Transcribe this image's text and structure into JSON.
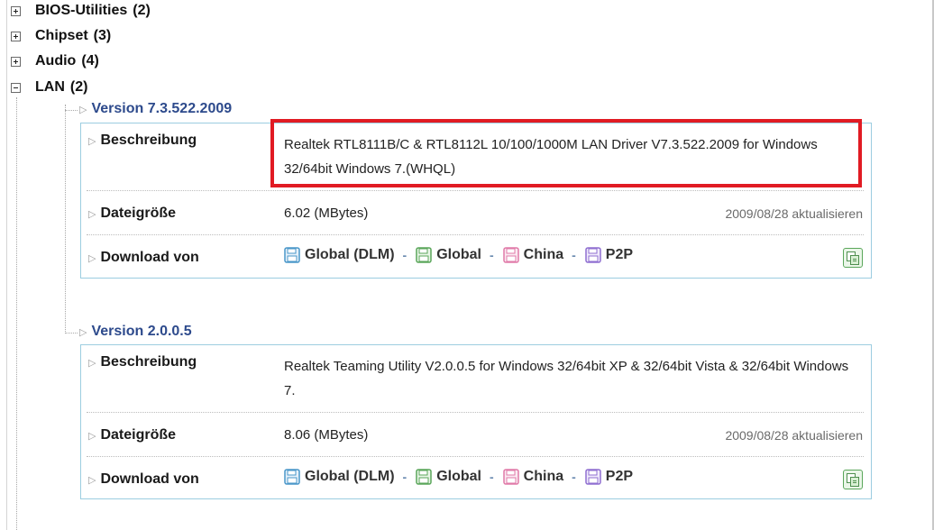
{
  "categories": [
    {
      "name": "BIOS-Utilities",
      "count": "(2)",
      "state": "collapsed"
    },
    {
      "name": "Chipset",
      "count": "(3)",
      "state": "collapsed"
    },
    {
      "name": "Audio",
      "count": "(4)",
      "state": "collapsed"
    },
    {
      "name": "LAN",
      "count": "(2)",
      "state": "expanded"
    }
  ],
  "field_labels": {
    "description": "Beschreibung",
    "filesize": "Dateigröße",
    "download": "Download von"
  },
  "download_links": [
    "Global (DLM)",
    "Global",
    "China",
    "P2P"
  ],
  "download_separator": "-",
  "entries": [
    {
      "version": "Version 7.3.522.2009",
      "description": "Realtek RTL8111B/C & RTL8112L 10/100/1000M LAN Driver V7.3.522.2009 for Windows 32/64bit Windows 7.(WHQL)",
      "filesize": "6.02 (MBytes)",
      "date": "2009/08/28 aktualisieren"
    },
    {
      "version": "Version 2.0.0.5",
      "description": "Realtek Teaming Utility V2.0.0.5 for Windows 32/64bit XP & 32/64bit Vista & 32/64bit Windows 7.",
      "filesize": "8.06 (MBytes)",
      "date": "2009/08/28 aktualisieren"
    }
  ],
  "colors": {
    "version_link": "#2d4a8c",
    "panel_border": "#9ccde0",
    "highlight_box": "#e11b23",
    "icon_global_dlm": "#4a97c9",
    "icon_global": "#5aa65a",
    "icon_china": "#e07aa8",
    "icon_p2p": "#8f6fd1"
  },
  "icons": {
    "expand": "plus-box-icon",
    "collapse": "minus-box-icon",
    "download": "floppy-disk-icon",
    "compare": "compare-pages-icon",
    "bullet": "chevron-right-icon"
  }
}
